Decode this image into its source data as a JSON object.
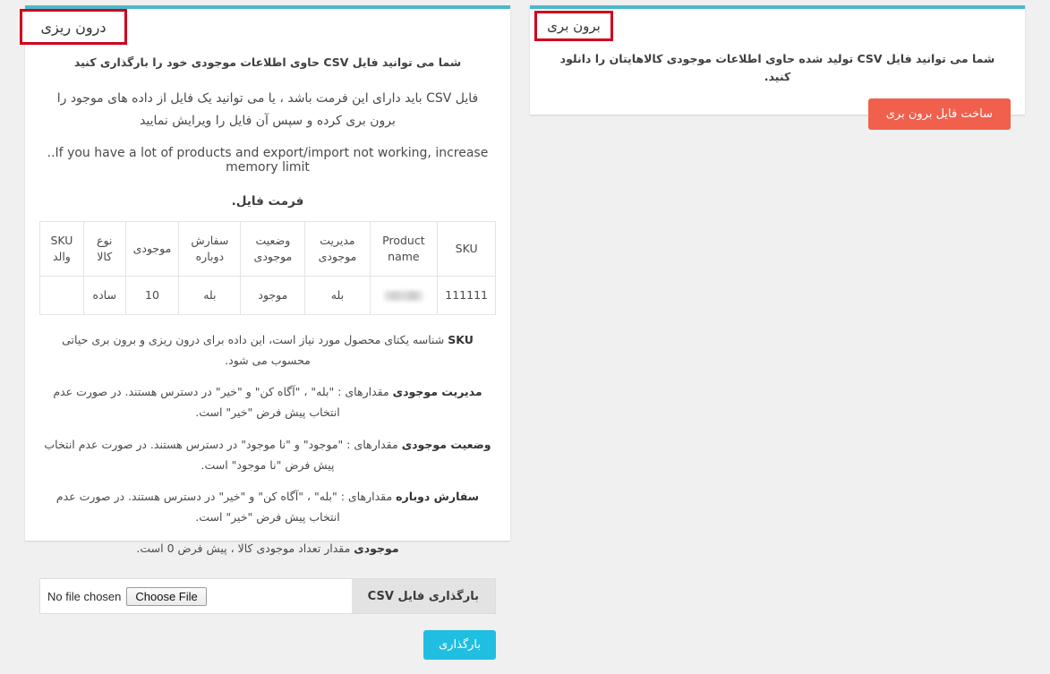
{
  "colors": {
    "page_background": "#f0f0f0",
    "card_accent": "#4bb8cb",
    "annotation_border": "#d0021b",
    "primary_button": "#20bee0",
    "danger_button": "#f0604c",
    "upload_label_background": "#e3e3e3"
  },
  "import_panel": {
    "title": "درون ریزی",
    "lead": "شما می توانید فایل CSV حاوی اطلاعات موجودی خود را بارگذاری کنید",
    "paragraph": "فایل CSV باید دارای این فرمت باشد ، یا می توانید یک فایل از داده های موجود را برون بری کرده و سپس آن فایل را ویرایش نمایید",
    "note_en": "..If you have a lot of products and export/import not working, increase memory limit",
    "format_heading": "فرمت فایل.",
    "table": {
      "headers": [
        "SKU",
        "Product name",
        "مدیریت موجودی",
        "وضعیت موجودی",
        "سفارش دوباره",
        "موجودی",
        "نوع کالا",
        "SKU والد"
      ],
      "rows": [
        [
          "111111",
          "",
          "بله",
          "موجود",
          "بله",
          "10",
          "ساده",
          ""
        ]
      ],
      "redacted_cell_index": 1
    },
    "descriptions": [
      {
        "term": "SKU",
        "text": " شناسه یکتای محصول مورد نیاز است، این داده برای درون ریزی و برون بری حیاتی محسوب می شود."
      },
      {
        "term": "مدیریت موجودی",
        "text": " مقدارهای : \"بله\" ، \"آگاه کن\" و \"خیر\" در دسترس هستند. در صورت عدم انتخاب پیش فرض \"خیر\" است."
      },
      {
        "term": "وضعیت موجودی",
        "text": " مقدارهای : \"موجود\" و \"نا موجود\" در دسترس هستند. در صورت عدم انتخاب پیش فرض \"نا موجود\" است."
      },
      {
        "term": "سفارش دوباره",
        "text": " مقدارهای : \"بله\" ، \"آگاه کن\" و \"خیر\" در دسترس هستند. در صورت عدم انتخاب پیش فرض \"خیر\" است."
      },
      {
        "term": "موجودی",
        "text": " مقدار تعداد موجودی کالا ، پیش فرض 0 است."
      }
    ],
    "upload": {
      "label": "بارگذاری فایل CSV",
      "choose_button": "Choose File",
      "file_status": "No file chosen"
    },
    "submit_button": "بارگذاری"
  },
  "export_panel": {
    "title": "برون بری",
    "lead": "شما می توانید فایل CSV تولید شده حاوی اطلاعات موجودی کالاهایتان را دانلود کنید.",
    "action_button": "ساخت فایل برون بری"
  }
}
